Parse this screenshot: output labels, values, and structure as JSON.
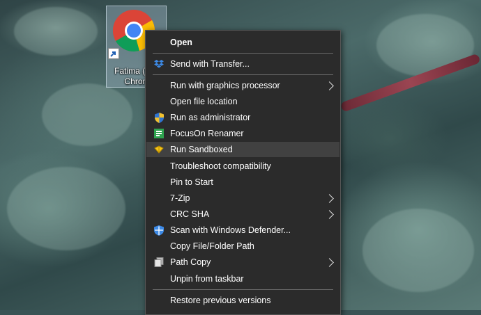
{
  "desktop": {
    "shortcut": {
      "label_line1": "Fatima (W...",
      "label_line2": "Chrom",
      "icon": "chrome-icon"
    }
  },
  "context_menu": {
    "items": [
      {
        "label": "Open",
        "bold": true,
        "icon": null,
        "submenu": false
      },
      {
        "label": "Send with Transfer...",
        "icon": "dropbox-icon",
        "submenu": false
      },
      {
        "label": "Run with graphics processor",
        "icon": null,
        "submenu": true
      },
      {
        "label": "Open file location",
        "icon": null,
        "submenu": false
      },
      {
        "label": "Run as administrator",
        "icon": "uac-shield-icon",
        "submenu": false
      },
      {
        "label": "FocusOn Renamer",
        "icon": "focuson-renamer-icon",
        "submenu": false
      },
      {
        "label": "Run Sandboxed",
        "icon": "sandboxie-icon",
        "submenu": false,
        "highlighted": true
      },
      {
        "label": "Troubleshoot compatibility",
        "icon": null,
        "submenu": false
      },
      {
        "label": "Pin to Start",
        "icon": null,
        "submenu": false
      },
      {
        "label": "7-Zip",
        "icon": null,
        "submenu": true
      },
      {
        "label": "CRC SHA",
        "icon": null,
        "submenu": true
      },
      {
        "label": "Scan with Windows Defender...",
        "icon": "windows-defender-icon",
        "submenu": false
      },
      {
        "label": "Copy File/Folder Path",
        "icon": null,
        "submenu": false
      },
      {
        "label": "Path Copy",
        "icon": "path-copy-icon",
        "submenu": true
      },
      {
        "label": "Unpin from taskbar",
        "icon": null,
        "submenu": false
      },
      {
        "label": "Restore previous versions",
        "icon": null,
        "submenu": false
      }
    ]
  }
}
